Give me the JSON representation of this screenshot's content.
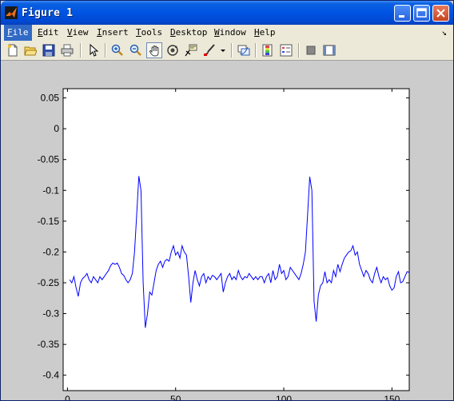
{
  "window": {
    "title": "Figure 1"
  },
  "menu": [
    {
      "label": "File",
      "u": "F",
      "rest": "ile"
    },
    {
      "label": "Edit",
      "u": "E",
      "rest": "dit"
    },
    {
      "label": "View",
      "u": "V",
      "rest": "iew"
    },
    {
      "label": "Insert",
      "u": "I",
      "rest": "nsert"
    },
    {
      "label": "Tools",
      "u": "T",
      "rest": "ools"
    },
    {
      "label": "Desktop",
      "u": "D",
      "rest": "esktop"
    },
    {
      "label": "Window",
      "u": "W",
      "rest": "indow"
    },
    {
      "label": "Help",
      "u": "H",
      "rest": "elp"
    }
  ],
  "toolbar": {
    "items": [
      "new-figure",
      "open-file",
      "save-figure",
      "print-figure",
      "edit-plot",
      "zoom-in",
      "zoom-out",
      "pan",
      "rotate-3d",
      "data-cursor",
      "brush",
      "brush-dropdown",
      "link-plot",
      "insert-colorbar",
      "insert-legend",
      "hide-plot-tools",
      "show-plot-tools"
    ]
  },
  "chart_data": {
    "type": "line",
    "title": "",
    "xlabel": "",
    "ylabel": "",
    "xlim": [
      -2,
      158
    ],
    "ylim": [
      -0.425,
      0.065
    ],
    "xticks": [
      0,
      50,
      100,
      150
    ],
    "yticks": [
      0.05,
      0,
      -0.05,
      -0.1,
      -0.15,
      -0.2,
      -0.25,
      -0.3,
      -0.35,
      -0.4
    ],
    "ytick_labels": [
      "0.05",
      "0",
      "-0.05",
      "-0.1",
      "-0.15",
      "-0.2",
      "-0.25",
      "-0.3",
      "-0.35",
      "-0.4"
    ],
    "xtick_labels": [
      "0",
      "50",
      "100",
      "150"
    ],
    "grid": false,
    "series": [
      {
        "color": "#0000ff",
        "x": [
          1,
          2,
          3,
          4,
          5,
          6,
          7,
          8,
          9,
          10,
          11,
          12,
          13,
          14,
          15,
          16,
          17,
          18,
          19,
          20,
          21,
          22,
          23,
          24,
          25,
          26,
          27,
          28,
          29,
          30,
          31,
          32,
          33,
          34,
          35,
          36,
          37,
          38,
          39,
          40,
          41,
          42,
          43,
          44,
          45,
          46,
          47,
          48,
          49,
          50,
          51,
          52,
          53,
          54,
          55,
          56,
          57,
          58,
          59,
          60,
          61,
          62,
          63,
          64,
          65,
          66,
          67,
          68,
          69,
          70,
          71,
          72,
          73,
          74,
          75,
          76,
          77,
          78,
          79,
          80,
          81,
          82,
          83,
          84,
          85,
          86,
          87,
          88,
          89,
          90,
          91,
          92,
          93,
          94,
          95,
          96,
          97,
          98,
          99,
          100,
          101,
          102,
          103,
          104,
          105,
          106,
          107,
          108,
          109,
          110,
          111,
          112,
          113,
          114,
          115,
          116,
          117,
          118,
          119,
          120,
          121,
          122,
          123,
          124,
          125,
          126,
          127,
          128,
          129,
          130,
          131,
          132,
          133,
          134,
          135,
          136,
          137,
          138,
          139,
          140,
          141,
          142,
          143,
          144,
          145,
          146,
          147,
          148,
          149,
          150,
          151,
          152,
          153,
          154,
          155,
          156,
          157,
          158
        ],
        "y": [
          -0.245,
          -0.25,
          -0.24,
          -0.258,
          -0.272,
          -0.25,
          -0.243,
          -0.24,
          -0.235,
          -0.245,
          -0.25,
          -0.24,
          -0.245,
          -0.25,
          -0.24,
          -0.245,
          -0.24,
          -0.235,
          -0.23,
          -0.222,
          -0.218,
          -0.22,
          -0.218,
          -0.225,
          -0.235,
          -0.238,
          -0.245,
          -0.25,
          -0.245,
          -0.235,
          -0.2,
          -0.14,
          -0.077,
          -0.1,
          -0.25,
          -0.323,
          -0.3,
          -0.265,
          -0.27,
          -0.25,
          -0.23,
          -0.22,
          -0.215,
          -0.225,
          -0.215,
          -0.212,
          -0.215,
          -0.2,
          -0.19,
          -0.205,
          -0.2,
          -0.21,
          -0.19,
          -0.2,
          -0.205,
          -0.24,
          -0.282,
          -0.25,
          -0.23,
          -0.245,
          -0.255,
          -0.24,
          -0.235,
          -0.25,
          -0.24,
          -0.245,
          -0.238,
          -0.24,
          -0.245,
          -0.24,
          -0.235,
          -0.265,
          -0.25,
          -0.24,
          -0.235,
          -0.245,
          -0.24,
          -0.245,
          -0.23,
          -0.24,
          -0.245,
          -0.24,
          -0.242,
          -0.235,
          -0.24,
          -0.245,
          -0.24,
          -0.245,
          -0.24,
          -0.24,
          -0.25,
          -0.24,
          -0.235,
          -0.25,
          -0.23,
          -0.245,
          -0.24,
          -0.22,
          -0.235,
          -0.23,
          -0.245,
          -0.24,
          -0.225,
          -0.23,
          -0.235,
          -0.24,
          -0.245,
          -0.235,
          -0.22,
          -0.2,
          -0.14,
          -0.078,
          -0.1,
          -0.28,
          -0.313,
          -0.27,
          -0.255,
          -0.25,
          -0.232,
          -0.25,
          -0.245,
          -0.25,
          -0.23,
          -0.24,
          -0.22,
          -0.232,
          -0.22,
          -0.21,
          -0.205,
          -0.2,
          -0.198,
          -0.19,
          -0.205,
          -0.2,
          -0.22,
          -0.23,
          -0.24,
          -0.23,
          -0.235,
          -0.245,
          -0.25,
          -0.235,
          -0.225,
          -0.24,
          -0.25,
          -0.24,
          -0.245,
          -0.242,
          -0.255,
          -0.262,
          -0.258,
          -0.24,
          -0.232,
          -0.25,
          -0.248,
          -0.24,
          -0.232,
          -0.233
        ]
      }
    ]
  }
}
